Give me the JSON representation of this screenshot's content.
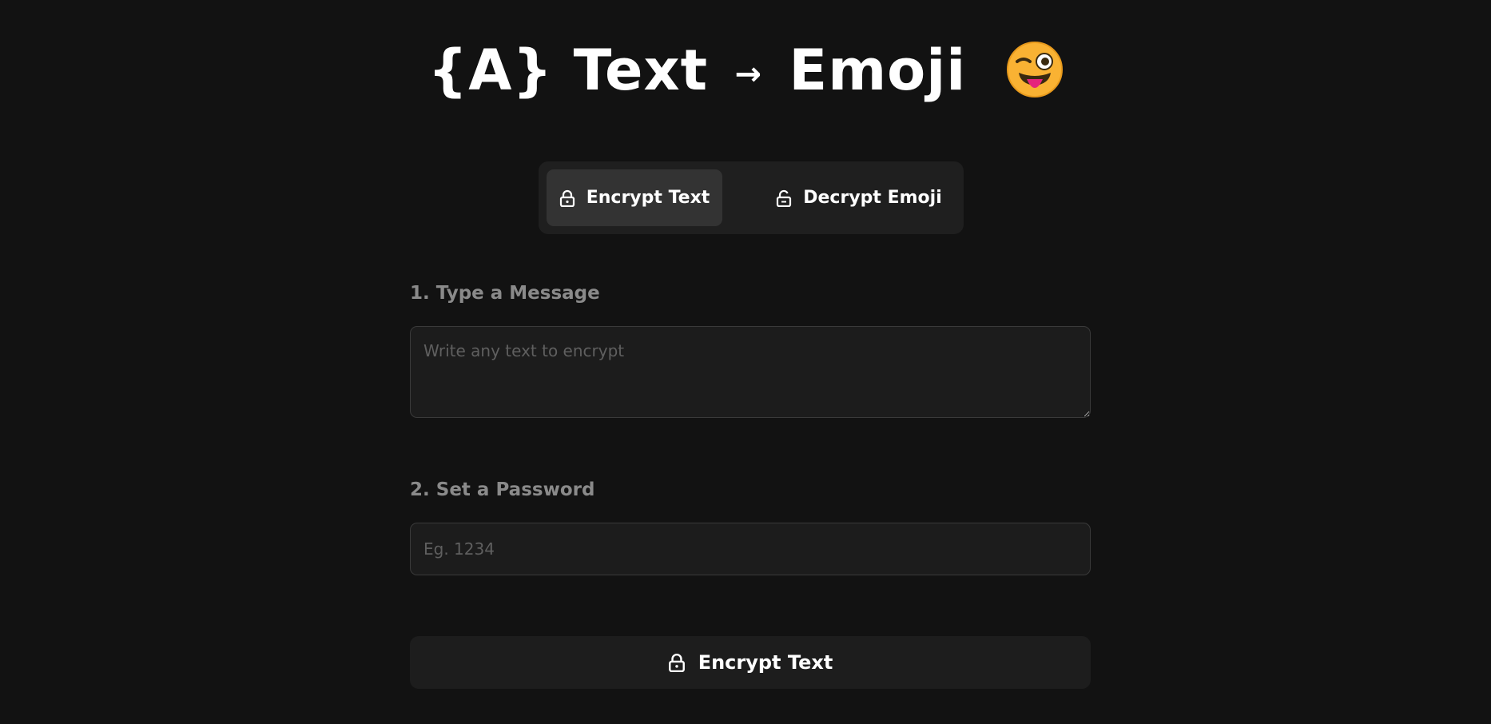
{
  "header": {
    "title_left": "{A} Text",
    "arrow": "→",
    "title_right": "Emoji",
    "emoji_icon": "winking-face-with-tongue-icon"
  },
  "tabs": [
    {
      "label": "Encrypt Text",
      "icon": "lock-icon",
      "active": true
    },
    {
      "label": "Decrypt Emoji",
      "icon": "unlock-icon",
      "active": false
    }
  ],
  "form": {
    "message_label": "1. Type a Message",
    "message_placeholder": "Write any text to encrypt",
    "message_value": "",
    "password_label": "2. Set a Password",
    "password_placeholder": "Eg. 1234",
    "password_value": "",
    "submit_label": "Encrypt Text",
    "submit_icon": "lock-icon"
  },
  "colors": {
    "background": "#121212",
    "panel": "#1f1f1f",
    "active_tab": "#333333",
    "input_bg": "#1c1c1c",
    "label": "#8a8a8a",
    "emoji_face": "#f9b233",
    "emoji_tongue": "#e5247c"
  }
}
